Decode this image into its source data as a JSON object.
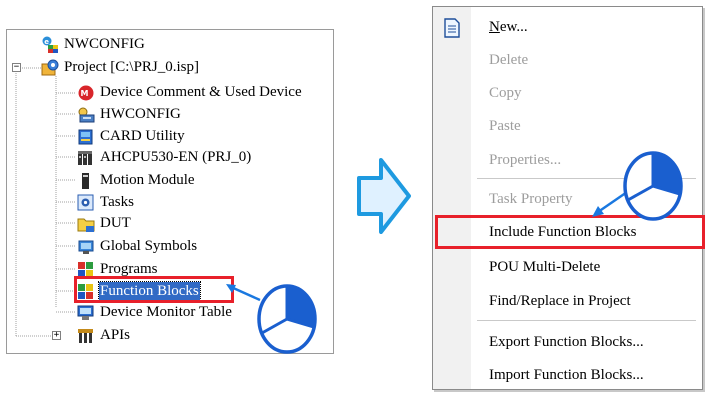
{
  "tree": {
    "items": [
      {
        "label": "NWCONFIG",
        "icon": "nwconfig-icon"
      },
      {
        "label": "Project [C:\\PRJ_0.isp]",
        "icon": "project-icon"
      },
      {
        "label": "Device Comment & Used Device",
        "icon": "device-comment-icon"
      },
      {
        "label": "HWCONFIG",
        "icon": "hwconfig-icon"
      },
      {
        "label": "CARD Utility",
        "icon": "card-utility-icon"
      },
      {
        "label": "AHCPU530-EN  (PRJ_0)",
        "icon": "cpu-icon"
      },
      {
        "label": "Motion Module",
        "icon": "motion-module-icon"
      },
      {
        "label": "Tasks",
        "icon": "tasks-icon"
      },
      {
        "label": "DUT",
        "icon": "dut-icon"
      },
      {
        "label": "Global Symbols",
        "icon": "global-symbols-icon"
      },
      {
        "label": "Programs",
        "icon": "programs-icon"
      },
      {
        "label": "Function Blocks",
        "icon": "function-blocks-icon"
      },
      {
        "label": "Device Monitor Table",
        "icon": "device-monitor-icon"
      },
      {
        "label": "APIs",
        "icon": "apis-icon"
      }
    ],
    "expander_project": "−",
    "expander_apis": "+"
  },
  "menu": {
    "new_prefix": "N",
    "new_suffix": "ew...",
    "delete": "Delete",
    "copy": "Copy",
    "paste": "Paste",
    "properties": "Properties...",
    "task_property": "Task Property",
    "include_function_blocks": "Include Function Blocks",
    "pou_multi_delete": "POU Multi-Delete",
    "find_replace": "Find/Replace in Project",
    "export_function_blocks": "Export Function Blocks...",
    "import_function_blocks": "Import Function Blocks..."
  },
  "colors": {
    "highlight": "#e8202a",
    "selection": "#316ac5",
    "arrow_fill": "#dff1ff",
    "arrow_stroke": "#1e9ae0",
    "pie_stroke": "#1a5fcf",
    "pie_fill": "#1a5fcf",
    "disabled_text": "#9d9d9d"
  }
}
